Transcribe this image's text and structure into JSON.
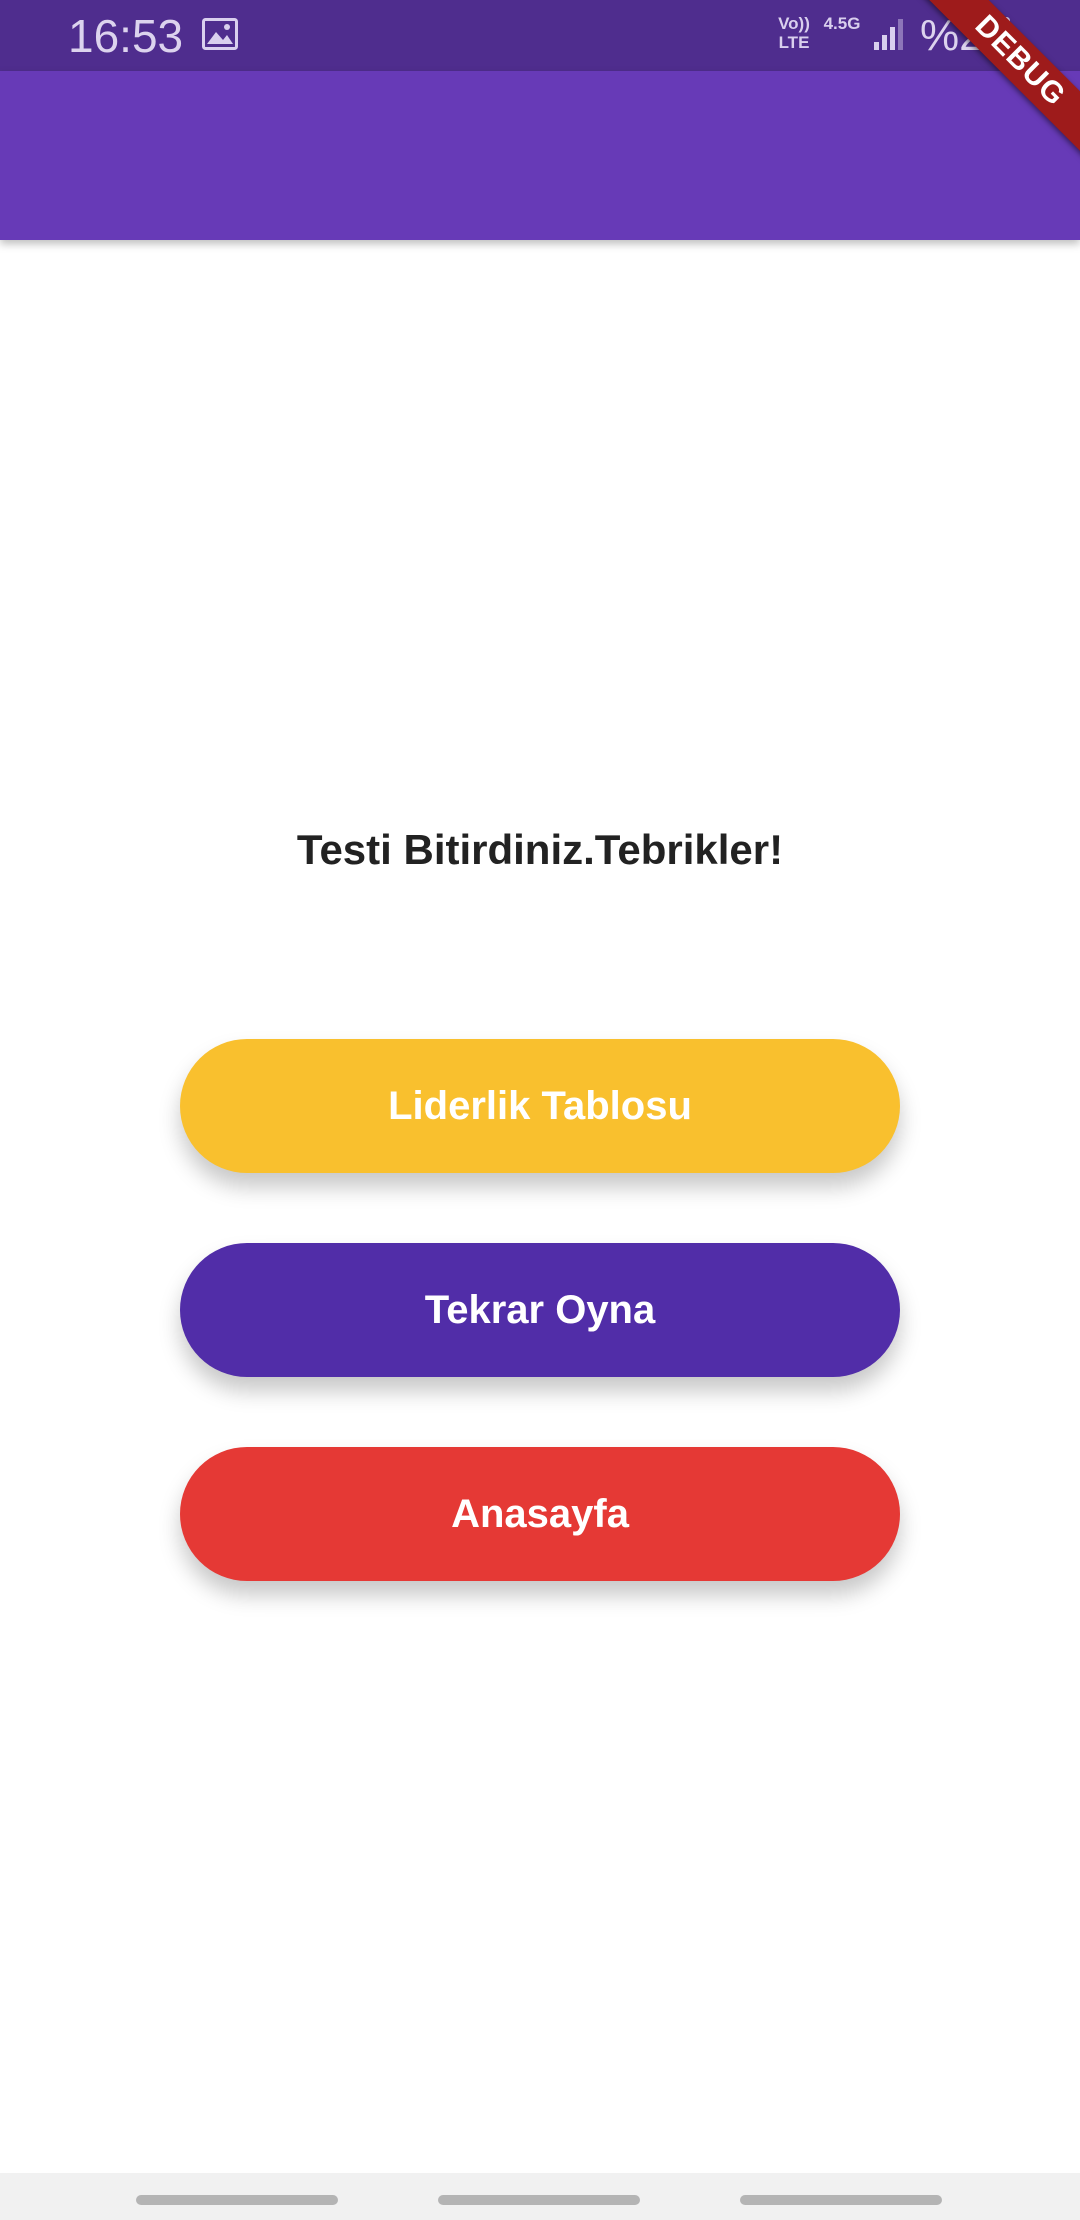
{
  "status_bar": {
    "time": "16:53",
    "volte_label": "Vo))\nLTE",
    "network_label": "4.5G",
    "battery_text": "%2",
    "icons": [
      "image-icon",
      "signal-icon",
      "battery-icon"
    ]
  },
  "debug_banner": {
    "label": "DEBUG"
  },
  "result": {
    "title": "Testi Bitirdiniz.Tebrikler!"
  },
  "buttons": {
    "leaderboard": "Liderlik Tablosu",
    "replay": "Tekrar Oyna",
    "home": "Anasayfa"
  },
  "colors": {
    "status_bar": "#4f2d8e",
    "app_bar": "#673ab7",
    "leaderboard_button": "#f9c02e",
    "replay_button": "#512da8",
    "home_button": "#e53935",
    "debug_banner": "#9e1b1b"
  }
}
